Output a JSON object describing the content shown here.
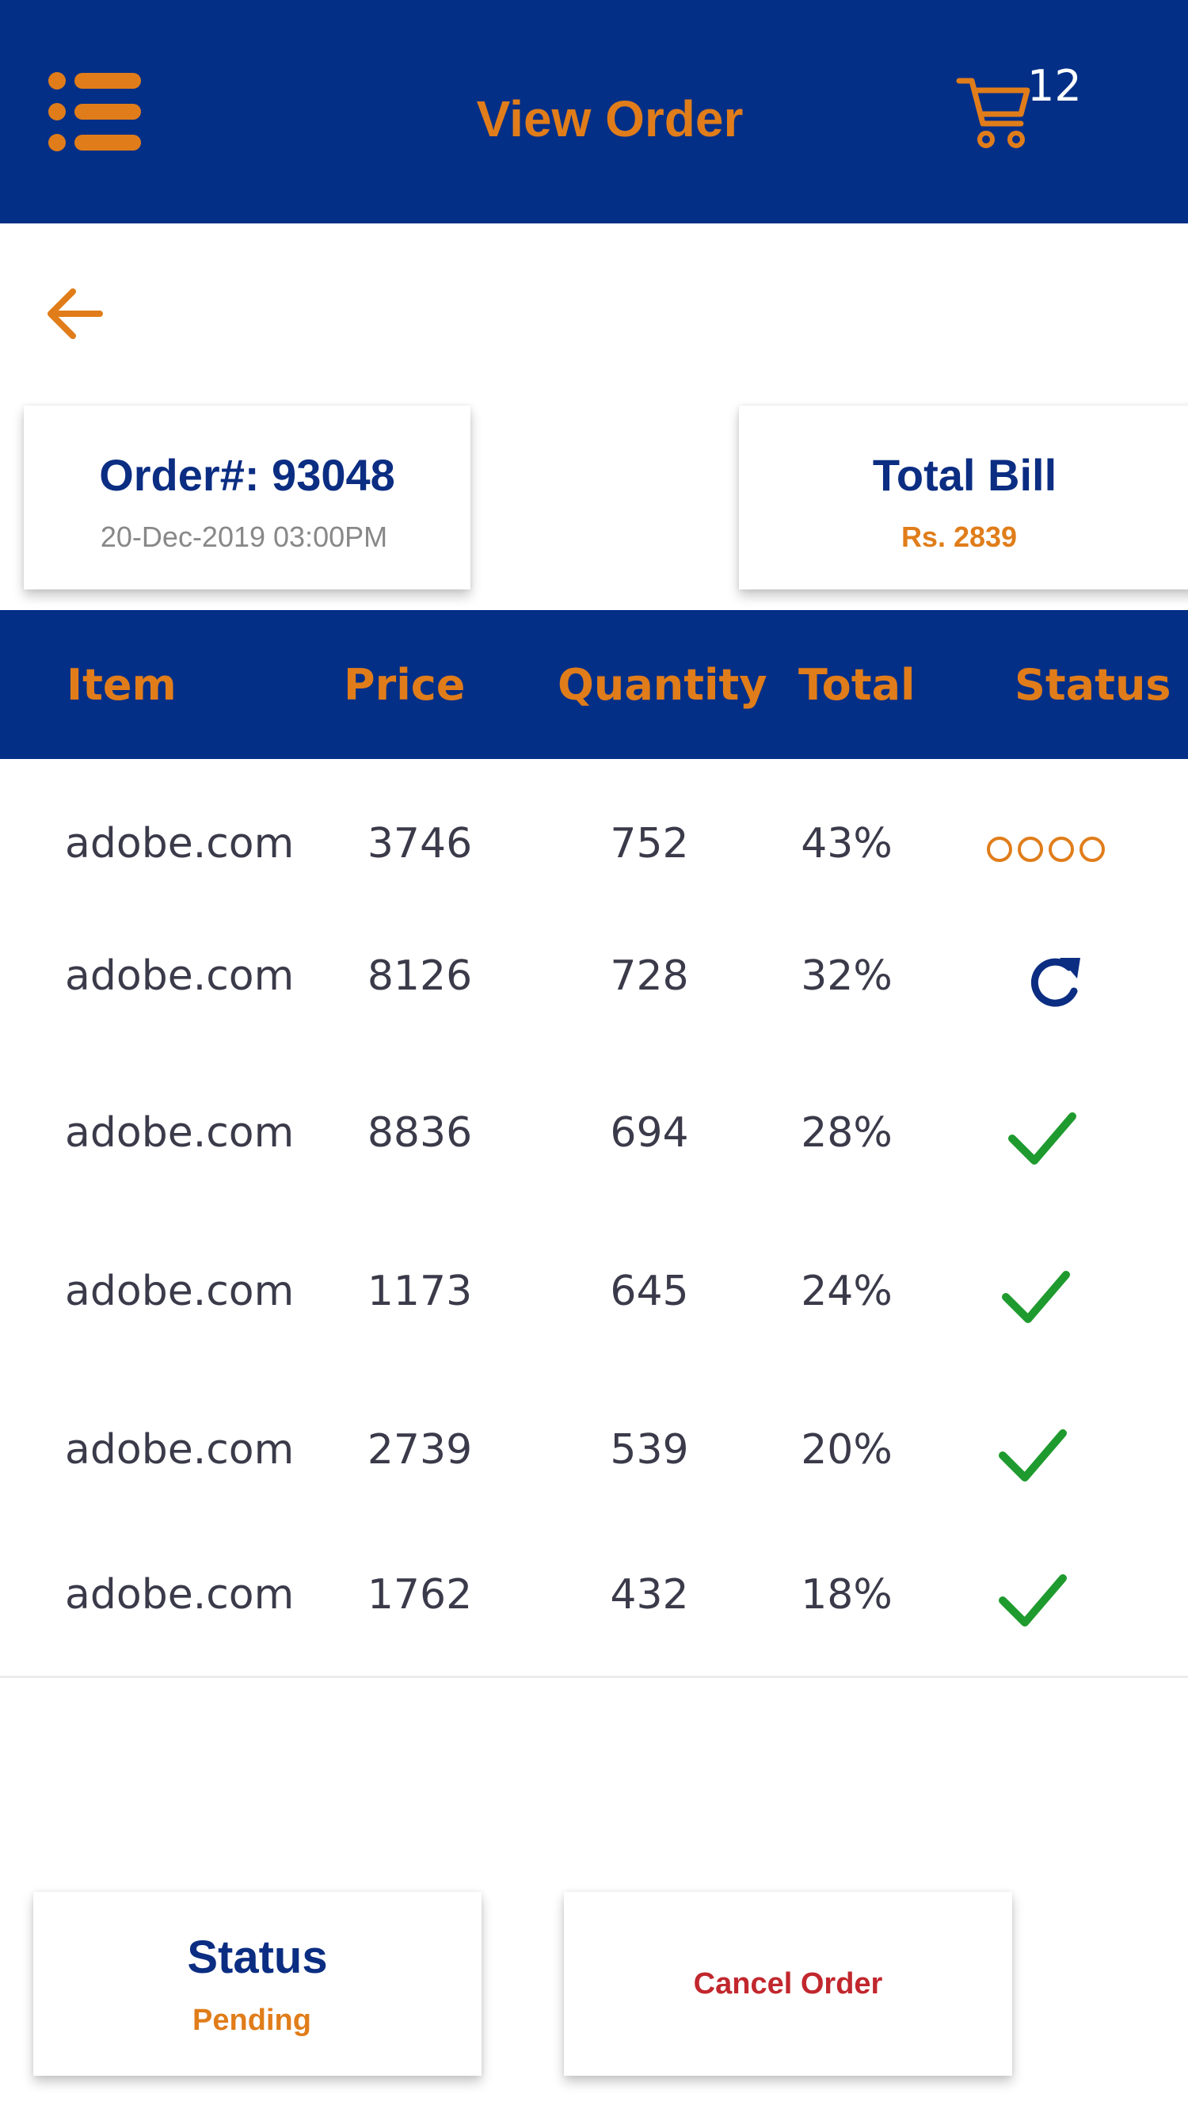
{
  "header": {
    "title": "View Order",
    "cart_count": "12",
    "colors": {
      "background": "#042f87",
      "accent": "#e07d1a"
    },
    "icons": {
      "menu": "menu-list-icon",
      "cart": "shopping-cart-icon"
    }
  },
  "back": {
    "icon": "arrow-left-icon"
  },
  "order": {
    "title": "Order#: 93048",
    "date": "20-Dec-2019 03:00PM"
  },
  "bill": {
    "title": "Total Bill",
    "amount": "Rs. 2839"
  },
  "table": {
    "columns": [
      "Item",
      "Price",
      "Quantity",
      "Total",
      "Status"
    ],
    "rows": [
      {
        "item": "adobe.com",
        "price": "3746",
        "quantity": "752",
        "total": "43%",
        "status": "pending",
        "status_icon": "loading-dots-icon"
      },
      {
        "item": "adobe.com",
        "price": "8126",
        "quantity": "728",
        "total": "32%",
        "status": "processing",
        "status_icon": "refresh-icon"
      },
      {
        "item": "adobe.com",
        "price": "8836",
        "quantity": "694",
        "total": "28%",
        "status": "done",
        "status_icon": "checkmark-icon"
      },
      {
        "item": "adobe.com",
        "price": "1173",
        "quantity": "645",
        "total": "24%",
        "status": "done",
        "status_icon": "checkmark-icon"
      },
      {
        "item": "adobe.com",
        "price": "2739",
        "quantity": "539",
        "total": "20%",
        "status": "done",
        "status_icon": "checkmark-icon"
      },
      {
        "item": "adobe.com",
        "price": "1762",
        "quantity": "432",
        "total": "18%",
        "status": "done",
        "status_icon": "checkmark-icon"
      }
    ],
    "status_colors": {
      "pending": "#e07d1a",
      "processing": "#0b2d82",
      "done": "#1f9a2e"
    }
  },
  "footer": {
    "status_title": "Status",
    "status_value": "Pending",
    "cancel_label": "Cancel Order",
    "cancel_color": "#c1272d"
  }
}
